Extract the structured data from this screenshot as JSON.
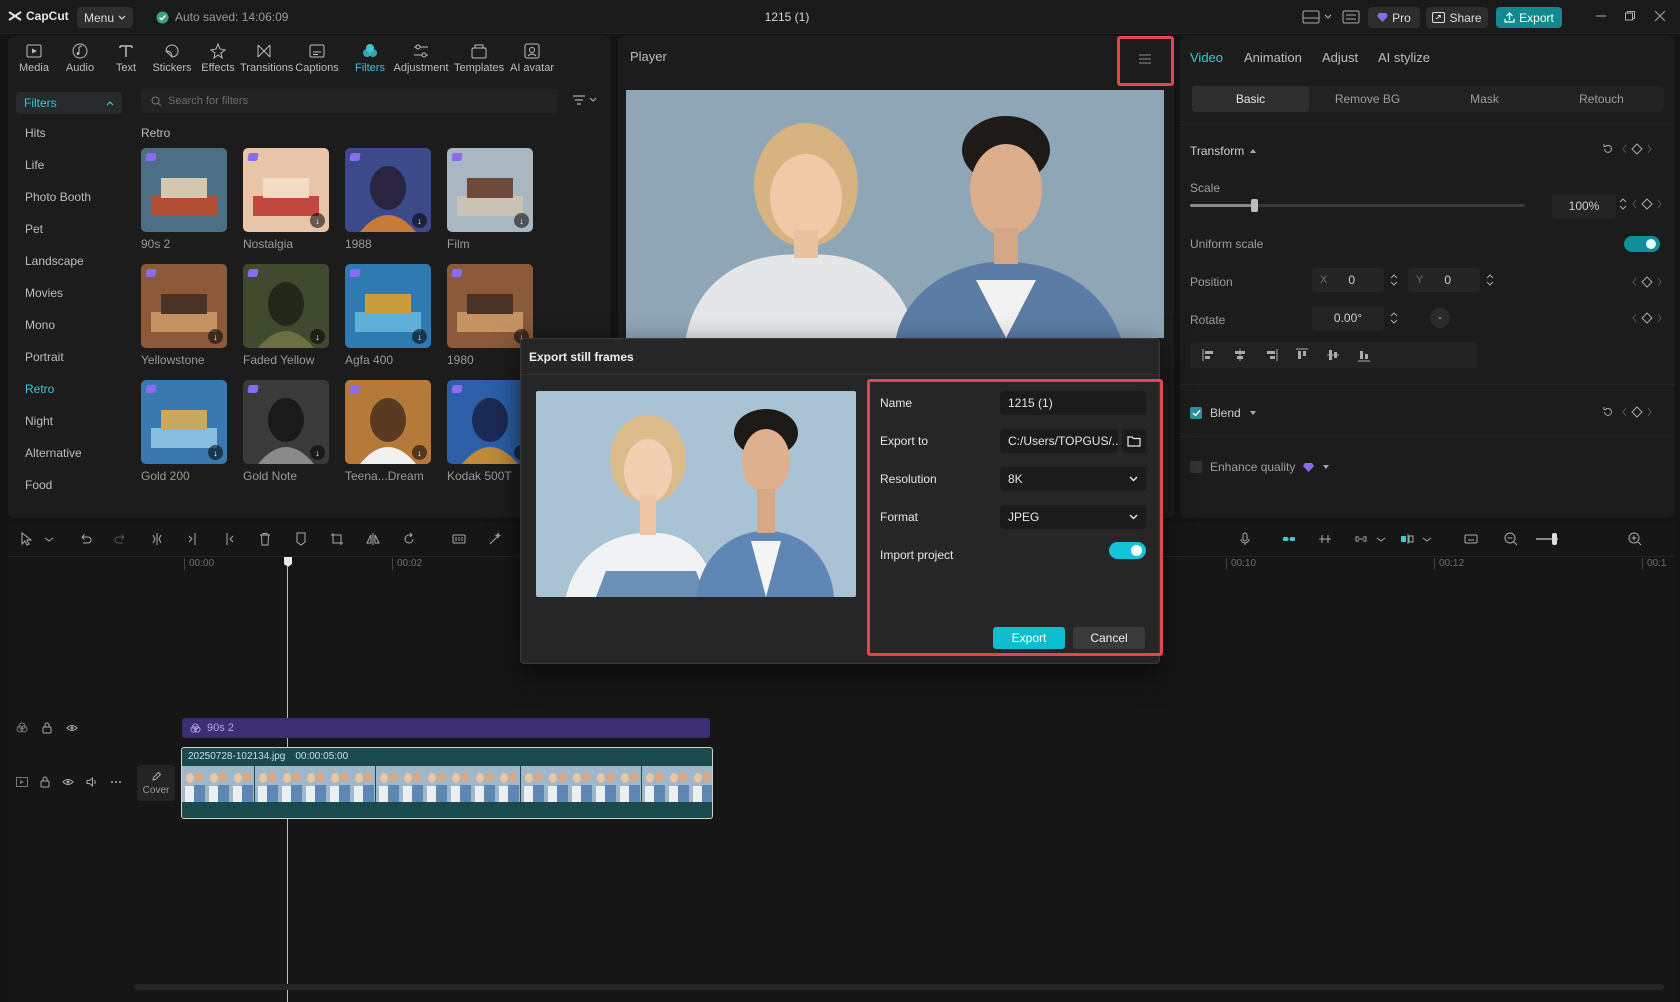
{
  "titlebar": {
    "app_name": "CapCut",
    "menu_label": "Menu",
    "autosave": "Auto saved: 14:06:09",
    "project_title": "1215 (1)",
    "pro_label": "Pro",
    "share_label": "Share",
    "export_label": "Export"
  },
  "toolbar": {
    "tools": [
      {
        "label": "Media",
        "icon": "media-icon"
      },
      {
        "label": "Audio",
        "icon": "audio-icon"
      },
      {
        "label": "Text",
        "icon": "text-icon"
      },
      {
        "label": "Stickers",
        "icon": "stickers-icon"
      },
      {
        "label": "Effects",
        "icon": "effects-icon"
      },
      {
        "label": "Transitions",
        "icon": "transitions-icon"
      },
      {
        "label": "Captions",
        "icon": "captions-icon"
      },
      {
        "label": "Filters",
        "icon": "filters-icon",
        "active": true
      },
      {
        "label": "Adjustment",
        "icon": "adjustment-icon"
      },
      {
        "label": "Templates",
        "icon": "templates-icon"
      },
      {
        "label": "AI avatar",
        "icon": "ai-avatar-icon"
      }
    ]
  },
  "filters": {
    "header": "Filters",
    "search_placeholder": "Search for filters",
    "section_title": "Retro",
    "categories": [
      "Hits",
      "Life",
      "Photo Booth",
      "Pet",
      "Landscape",
      "Movies",
      "Mono",
      "Portrait",
      "Retro",
      "Night",
      "Alternative",
      "Food"
    ],
    "active_category": "Retro",
    "items": [
      {
        "label": "90s 2"
      },
      {
        "label": "Nostalgia"
      },
      {
        "label": "1988"
      },
      {
        "label": "Film"
      },
      {
        "label": "Yellowstone"
      },
      {
        "label": "Faded Yellow"
      },
      {
        "label": "Agfa 400"
      },
      {
        "label": "1980"
      },
      {
        "label": "Gold 200"
      },
      {
        "label": "Gold Note"
      },
      {
        "label": "Teena...Dream"
      },
      {
        "label": "Kodak 500T"
      }
    ]
  },
  "player": {
    "title": "Player"
  },
  "inspector": {
    "tabs": [
      "Video",
      "Animation",
      "Adjust",
      "AI stylize"
    ],
    "subtabs": [
      "Basic",
      "Remove BG",
      "Mask",
      "Retouch"
    ],
    "transform_label": "Transform",
    "scale_label": "Scale",
    "scale_value": "100%",
    "scale_fraction": 0.19,
    "uniform_scale_label": "Uniform scale",
    "position_label": "Position",
    "pos_x_label": "X",
    "pos_x": "0",
    "pos_y_label": "Y",
    "pos_y": "0",
    "rotate_label": "Rotate",
    "rotate_value": "0.00°",
    "rotate_dash": "-",
    "blend_label": "Blend",
    "enhance_label": "Enhance quality"
  },
  "timeline": {
    "ticks": [
      "00:00",
      "00:02",
      "00:10",
      "00:12",
      "00:1"
    ],
    "filter_clip": "90s 2",
    "video_clip_name": "20250728-102134.jpg",
    "video_clip_duration": "00:00:05:00",
    "cover_label": "Cover"
  },
  "dialog": {
    "title": "Export still frames",
    "name_label": "Name",
    "name_value": "1215 (1)",
    "export_to_label": "Export to",
    "export_to_value": "C:/Users/TOPGUS/...",
    "resolution_label": "Resolution",
    "resolution_value": "8K",
    "format_label": "Format",
    "format_value": "JPEG",
    "import_label": "Import project",
    "export_button": "Export",
    "cancel_button": "Cancel"
  },
  "colors": {
    "accent": "#3ec7d2",
    "export_button": "#0fbcd0",
    "highlight": "#e2474d"
  }
}
